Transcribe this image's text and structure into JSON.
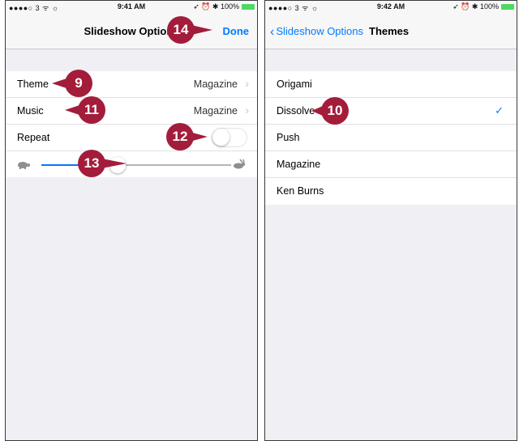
{
  "left_screen": {
    "status": {
      "carrier": "●●●●○ 3 ᯤ ☼",
      "time": "9:41 AM",
      "right": "➶ ⏰ ✱ 100%"
    },
    "nav": {
      "title": "Slideshow Options",
      "done_label": "Done"
    },
    "rows": [
      {
        "label": "Theme",
        "value": "Magazine"
      },
      {
        "label": "Music",
        "value": "Magazine"
      },
      {
        "label": "Repeat"
      }
    ],
    "repeat_on": false,
    "speed": 0.4,
    "callouts": {
      "theme": "9",
      "music": "11",
      "repeat": "12",
      "speed": "13",
      "done": "14"
    }
  },
  "right_screen": {
    "status": {
      "carrier": "●●●●○ 3 ᯤ ☼",
      "time": "9:42 AM",
      "right": "➶ ⏰ ✱ 100%"
    },
    "nav": {
      "back_label": "Slideshow Options",
      "title": "Themes"
    },
    "themes": [
      {
        "label": "Origami",
        "selected": false
      },
      {
        "label": "Dissolve",
        "selected": true
      },
      {
        "label": "Push",
        "selected": false
      },
      {
        "label": "Magazine",
        "selected": false
      },
      {
        "label": "Ken Burns",
        "selected": false
      }
    ],
    "check_mark": "✓",
    "callouts": {
      "dissolve": "10"
    }
  },
  "colors": {
    "accent": "#007aff",
    "callout": "#a31d3b",
    "battery": "#4cd964"
  },
  "icons": {
    "disclosure": "›",
    "back": "‹"
  }
}
